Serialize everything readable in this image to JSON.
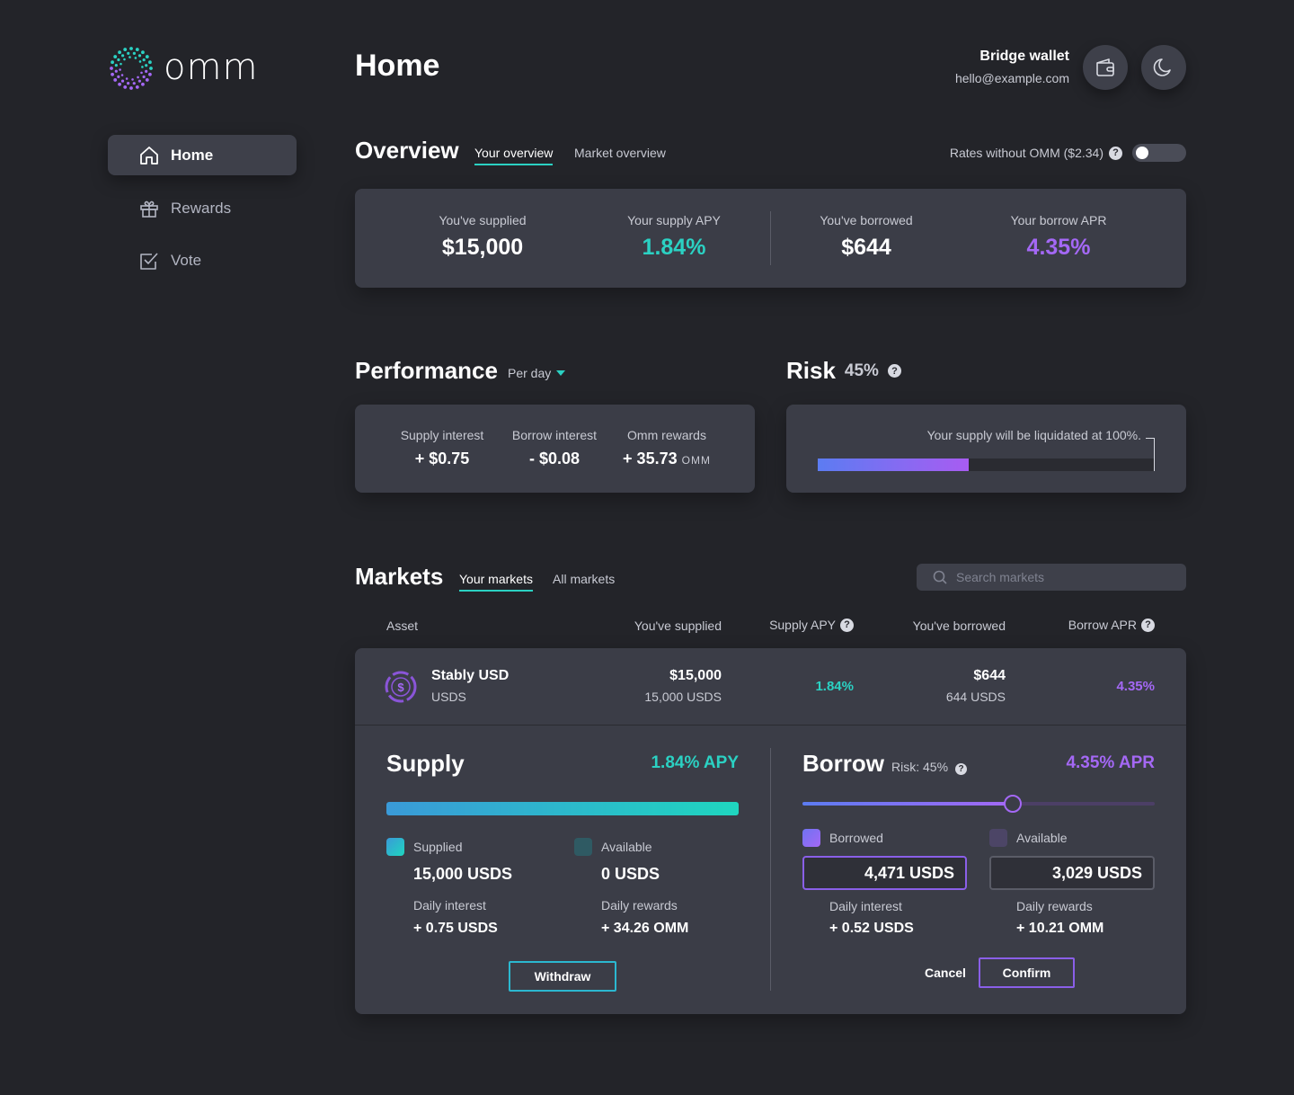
{
  "brand": {
    "name": "omm"
  },
  "sidebar": {
    "items": [
      {
        "label": "Home",
        "icon": "home-icon",
        "active": true
      },
      {
        "label": "Rewards",
        "icon": "gift-icon",
        "active": false
      },
      {
        "label": "Vote",
        "icon": "checkbox-icon",
        "active": false
      }
    ]
  },
  "header": {
    "title": "Home",
    "wallet_name": "Bridge wallet",
    "wallet_email": "hello@example.com",
    "wallet_icon": "wallet-icon",
    "theme_icon": "moon-icon"
  },
  "overview": {
    "title": "Overview",
    "tabs": [
      "Your overview",
      "Market overview"
    ],
    "rates_toggle_label": "Rates without OMM ($2.34)",
    "rates_toggle_on": false,
    "stats": [
      {
        "label": "You've supplied",
        "value": "$15,000"
      },
      {
        "label": "Your supply APY",
        "value": "1.84%"
      },
      {
        "label": "You've borrowed",
        "value": "$644"
      },
      {
        "label": "Your borrow APR",
        "value": "4.35%"
      }
    ]
  },
  "performance": {
    "title": "Performance",
    "period": "Per day",
    "items": [
      {
        "label": "Supply interest",
        "value": "+ $0.75"
      },
      {
        "label": "Borrow interest",
        "value": "- $0.08"
      },
      {
        "label": "Omm rewards",
        "value": "+ 35.73",
        "unit": "OMM"
      }
    ]
  },
  "risk": {
    "title": "Risk",
    "value": "45%",
    "level": 0.45,
    "note": "Your supply will be liquidated at 100%."
  },
  "markets": {
    "title": "Markets",
    "tabs": [
      "Your markets",
      "All markets"
    ],
    "search_placeholder": "Search markets",
    "columns": [
      "Asset",
      "You've supplied",
      "Supply APY",
      "You've borrowed",
      "Borrow APR"
    ],
    "row": {
      "name": "Stably USD",
      "symbol": "USDS",
      "supplied_usd": "$15,000",
      "supplied_amount": "15,000 USDS",
      "supply_apy": "1.84%",
      "borrowed_usd": "$644",
      "borrowed_amount": "644 USDS",
      "borrow_apr": "4.35%"
    }
  },
  "supply_panel": {
    "title": "Supply",
    "apy": "1.84% APY",
    "fill": 1.0,
    "supplied_label": "Supplied",
    "supplied_value": "15,000 USDS",
    "available_label": "Available",
    "available_value": "0 USDS",
    "daily_interest_label": "Daily interest",
    "daily_interest_value": "+ 0.75 USDS",
    "daily_rewards_label": "Daily rewards",
    "daily_rewards_value": "+ 34.26 OMM",
    "withdraw_label": "Withdraw"
  },
  "borrow_panel": {
    "title": "Borrow",
    "risk_label": "Risk: 45%",
    "apr": "4.35% APR",
    "slider_level": 0.598,
    "borrowed_label": "Borrowed",
    "borrowed_value": "4,471 USDS",
    "available_label": "Available",
    "available_value": "3,029 USDS",
    "daily_interest_label": "Daily interest",
    "daily_interest_value": "+ 0.52 USDS",
    "daily_rewards_label": "Daily rewards",
    "daily_rewards_value": "+ 10.21 OMM",
    "cancel_label": "Cancel",
    "confirm_label": "Confirm"
  },
  "colors": {
    "background": "#232429",
    "card": "#3b3d47",
    "teal": "#2bd1c3",
    "purple": "#a468f5",
    "blue": "#4a84f2"
  }
}
